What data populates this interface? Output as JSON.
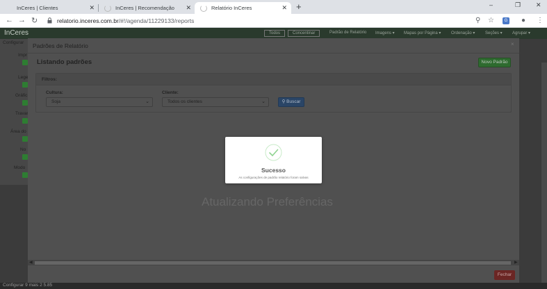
{
  "browser": {
    "tabs": [
      {
        "title": "InCeres | Clientes",
        "active": false
      },
      {
        "title": "InCeres | Recomendação",
        "active": false
      },
      {
        "title": "Relatório InCeres",
        "active": true
      }
    ],
    "new_tab_symbol": "+",
    "close_symbol": "✕",
    "url_host": "relatorio.inceres.com.br",
    "url_path": "/#!/agenda/11229133/reports",
    "window_controls": [
      "minimize-icon",
      "maximize-icon",
      "close-icon"
    ]
  },
  "app": {
    "logo": "InCeres",
    "nav": [
      "Todos",
      "Concentinar",
      "Padrão de Relatório",
      "Imagens ▾",
      "Mapas por Página ▾",
      "Ordenação ▾",
      "Seções ▾",
      "Agrupar ▾"
    ],
    "left_panel": {
      "title": "Configurar",
      "items": [
        "Impr",
        "Legen",
        "Gráfic",
        "Travar",
        "Área do",
        "No",
        "Modo"
      ]
    },
    "background_text": "Atualizando Preferências",
    "footer_text": "Configurar 9 mais 2 5.85"
  },
  "modal": {
    "title": "Padrões de Relatório",
    "close_symbol": "×",
    "heading": "Listando padrões",
    "new_button": "Novo Padrão",
    "filters_title": "Filtros:",
    "culture_label": "Cultura:",
    "culture_value": "Soja",
    "client_label": "Cliente:",
    "client_value": "Todos os clientes",
    "search_button": "Buscar",
    "close_button": "Fechar",
    "scroll_left": "◀",
    "scroll_right": "▶"
  },
  "alert": {
    "title": "Sucesso",
    "message": "As configurações de padrão relatório foram salvas"
  },
  "colors": {
    "success": "#8ed38f",
    "primary": "#337ab7",
    "success_button": "#4cae4c",
    "danger": "#d9534f"
  }
}
